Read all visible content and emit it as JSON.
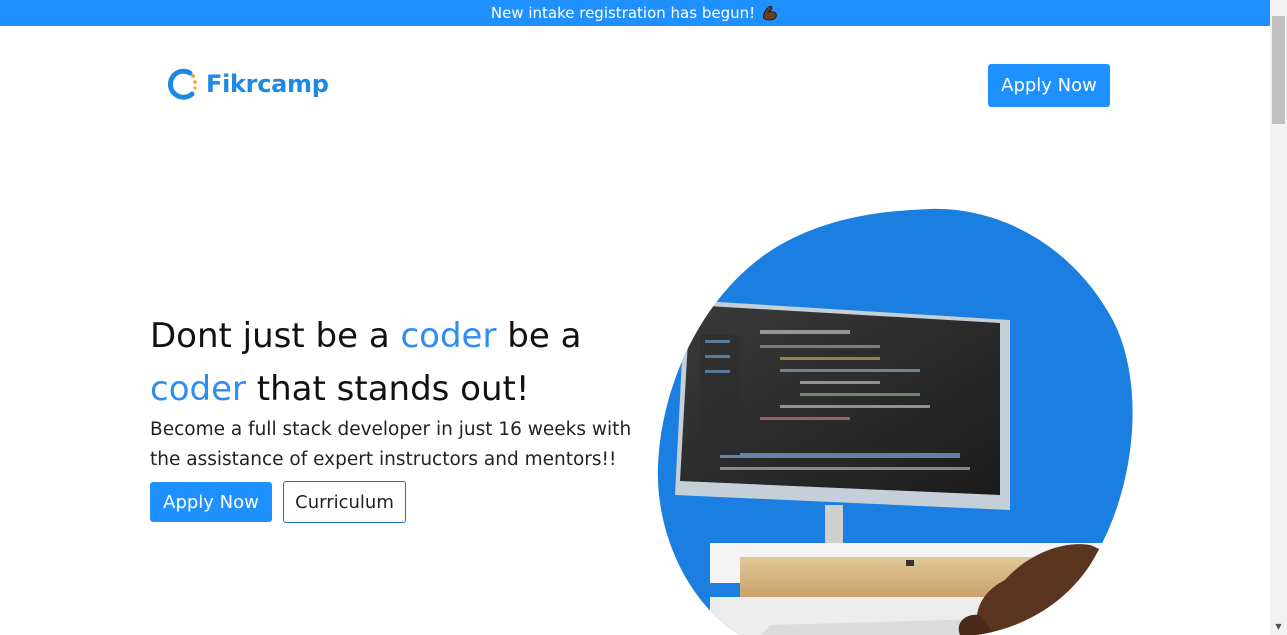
{
  "announcement": {
    "text": "New intake registration has begun!",
    "emoji_icon": "flexed-biceps-icon"
  },
  "header": {
    "brand": "Fikrcamp",
    "apply_label": "Apply Now"
  },
  "hero": {
    "title_part1": "Dont just be a ",
    "title_accent1": "coder",
    "title_part2": " be a ",
    "title_accent2": "coder",
    "title_part3": " that stands out!",
    "subtitle": "Become a full stack developer in just 16 weeks with the assistance of expert instructors and mentors!!",
    "apply_label": "Apply Now",
    "curriculum_label": "Curriculum",
    "image_icon": "computer-coding-photo"
  },
  "colors": {
    "brand": "#1e90ff",
    "accent_text": "#2e8ef0",
    "logo": "#1e88e5"
  }
}
